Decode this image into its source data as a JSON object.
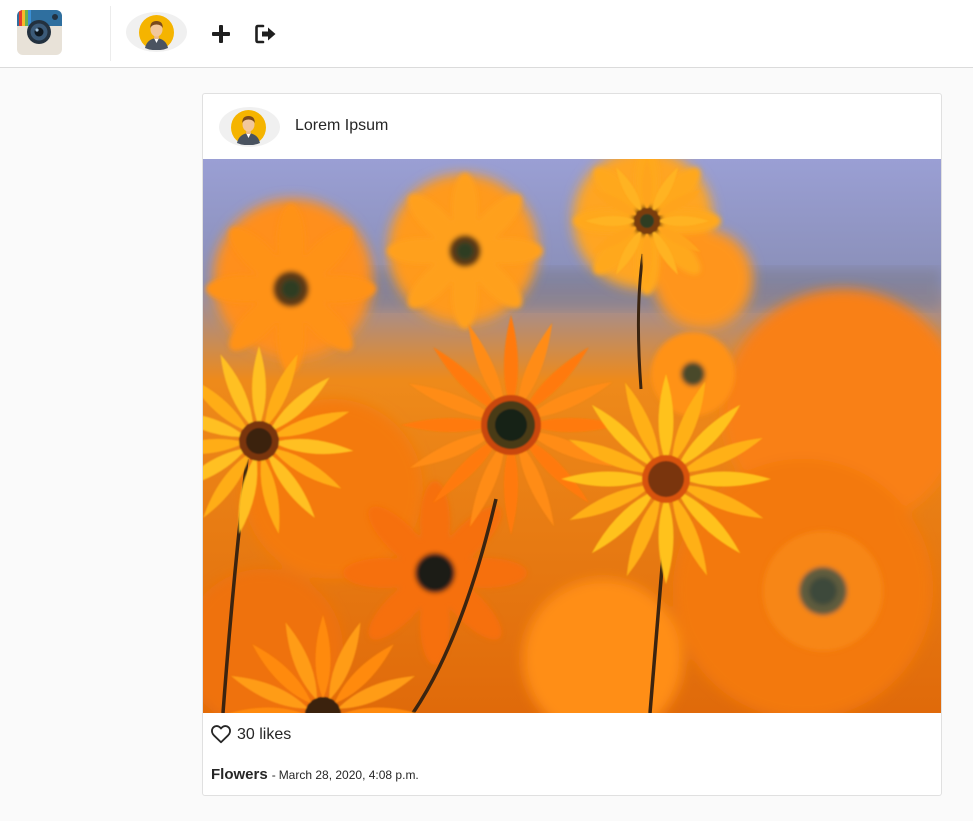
{
  "nav": {
    "logo_icon": "camera-app-icon",
    "avatar_icon": "user-avatar-icon",
    "add_icon": "plus-icon",
    "logout_icon": "sign-out-icon"
  },
  "post": {
    "username": "Lorem Ipsum",
    "avatar_icon": "user-avatar-icon",
    "image_description_icon": "orange-flowers-photo",
    "likes_label": "30 likes",
    "heart_icon": "heart-outline-icon",
    "caption_title": "Flowers",
    "separator": "-",
    "timestamp": "March 28, 2020, 4:08 p.m."
  },
  "colors": {
    "background": "#fafafa",
    "card": "#ffffff",
    "avatar_bg": "#f0f0f0",
    "avatar_yellow": "#f5b400",
    "text": "#262626"
  }
}
